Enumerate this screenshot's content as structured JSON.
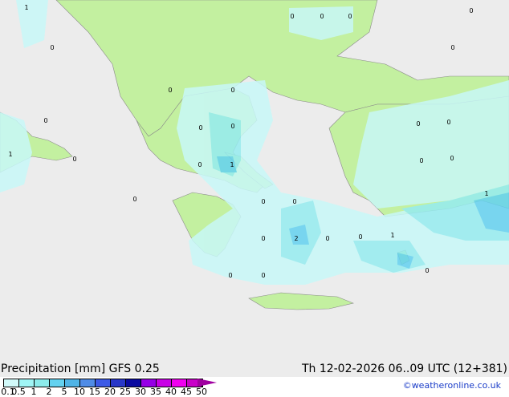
{
  "map": {
    "colors": {
      "sea": "#ececec",
      "land": "#c3f0a0",
      "precip_light": "#c8f8f8",
      "precip_mid": "#96ecf0",
      "precip_heavy": "#64d2f0",
      "coast": "#8a8a8a"
    },
    "point_labels": [
      {
        "text": "1"
      },
      {
        "text": "0"
      },
      {
        "text": "0"
      },
      {
        "text": "0"
      },
      {
        "text": "0"
      },
      {
        "text": "0"
      },
      {
        "text": "0"
      },
      {
        "text": "0"
      },
      {
        "text": "1"
      },
      {
        "text": "0"
      },
      {
        "text": "0"
      },
      {
        "text": "0"
      },
      {
        "text": "0"
      },
      {
        "text": "0"
      },
      {
        "text": "1"
      },
      {
        "text": "0"
      },
      {
        "text": "0"
      },
      {
        "text": "0"
      },
      {
        "text": "0"
      },
      {
        "text": "0"
      },
      {
        "text": "2"
      },
      {
        "text": "0"
      },
      {
        "text": "0"
      },
      {
        "text": "1"
      },
      {
        "text": "0"
      },
      {
        "text": "0"
      },
      {
        "text": "0"
      },
      {
        "text": "0"
      },
      {
        "text": "1"
      },
      {
        "text": "0"
      },
      {
        "text": "0"
      },
      {
        "text": "0"
      }
    ]
  },
  "legend": {
    "title": "Precipitation [mm]  GFS 0.25",
    "valid_time": "Th 12-02-2026 06..09 UTC (12+381)",
    "credit": "©weatheronline.co.uk",
    "scale_colors": [
      "#d2fafa",
      "#a0f5f5",
      "#8cebeb",
      "#64d2f0",
      "#50b4e6",
      "#508ce6",
      "#3c5ae6",
      "#2837c8",
      "#0a0aa0",
      "#9600e6",
      "#c800e6",
      "#f000f0",
      "#c800c8"
    ],
    "arrow_color": "#a000a0",
    "ticks": [
      "0.1",
      "0.5",
      "1",
      "2",
      "5",
      "10",
      "15",
      "20",
      "25",
      "30",
      "35",
      "40",
      "45",
      "50"
    ]
  }
}
